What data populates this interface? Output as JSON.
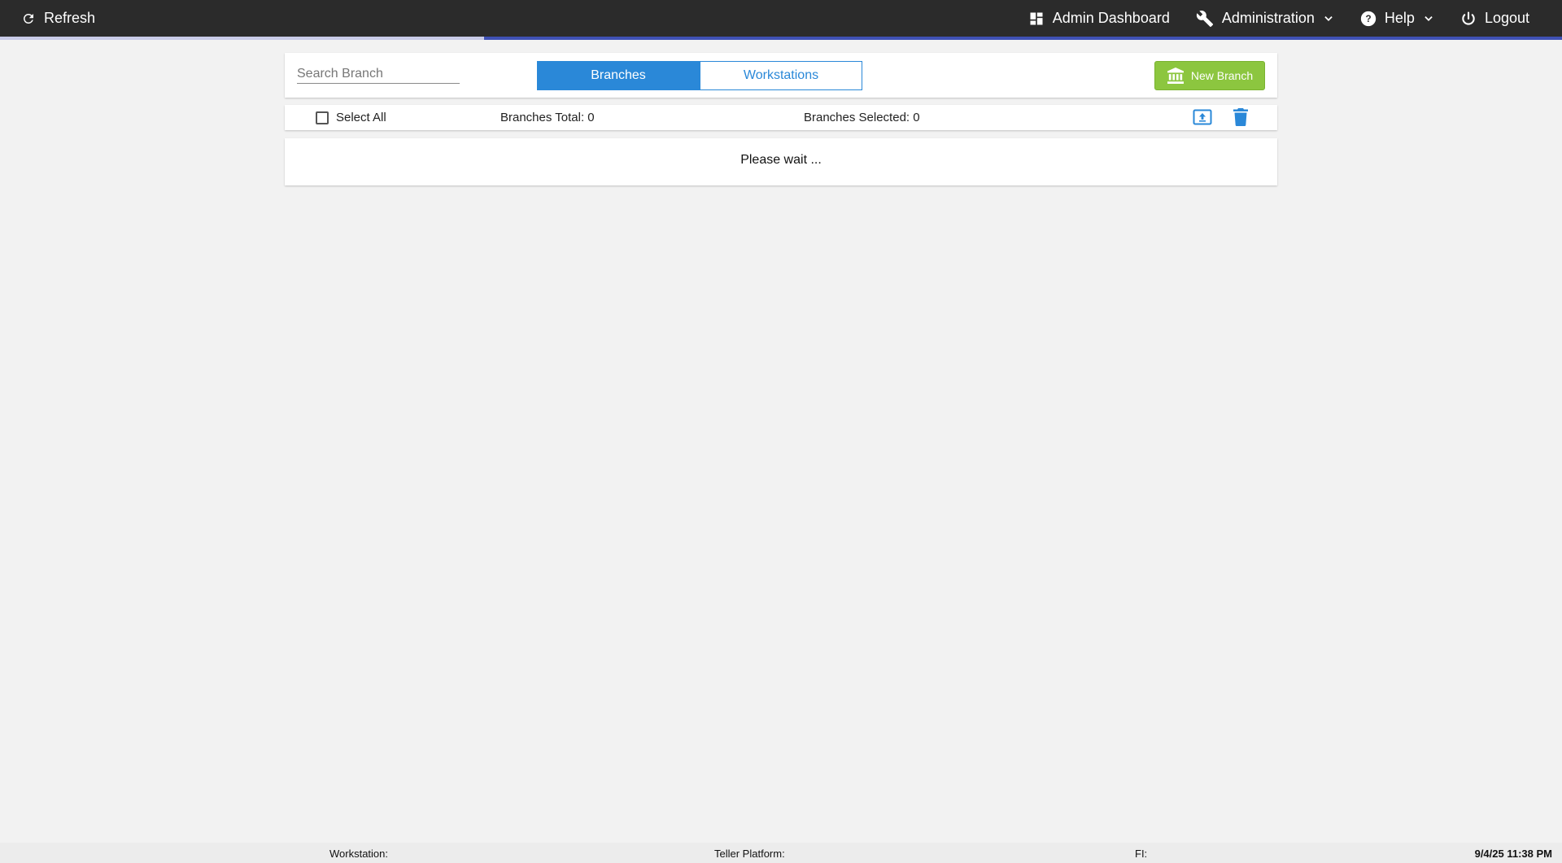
{
  "header": {
    "refresh_label": "Refresh",
    "admin_dashboard_label": "Admin Dashboard",
    "administration_label": "Administration",
    "help_label": "Help",
    "logout_label": "Logout",
    "loading_progress": 0.69
  },
  "toolbar": {
    "search_placeholder": "Search Branch",
    "search_value": "",
    "tabs": [
      {
        "label": "Branches",
        "active": true
      },
      {
        "label": "Workstations",
        "active": false
      }
    ],
    "new_branch_label": "New Branch"
  },
  "listbar": {
    "select_all_label": "Select All",
    "select_all_checked": false,
    "branches_total": "Branches Total: 0",
    "branches_selected": "Branches Selected: 0"
  },
  "content": {
    "status_text": "Please wait ..."
  },
  "footer": {
    "workstation_label": "Workstation:",
    "teller_platform_label": "Teller Platform:",
    "fi_label": "FI:",
    "datetime": "9/4/25 11:38 PM"
  },
  "colors": {
    "topbar": "#2b2b2b",
    "accent_blue": "#2a88d8",
    "new_branch_green": "#8cc63f",
    "progress": "#3f51b5"
  },
  "icons": {
    "refresh": "refresh-icon",
    "dashboard": "dashboard-icon",
    "administration": "wrench-icon",
    "help": "help-icon",
    "logout": "power-icon",
    "new_branch": "bank-icon",
    "export": "upload-icon",
    "delete": "trash-icon"
  }
}
